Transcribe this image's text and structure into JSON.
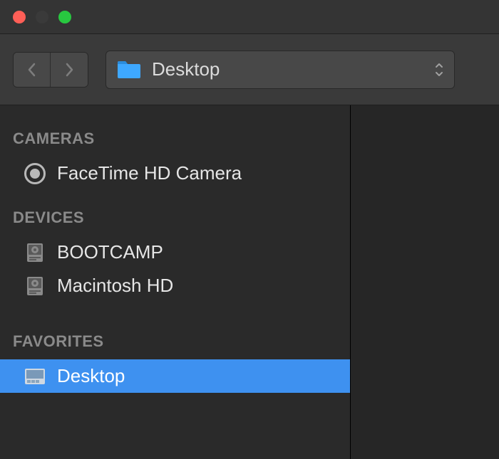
{
  "titlebar": {
    "traffic": {
      "close": "close",
      "minimize": "minimize",
      "maximize": "maximize"
    }
  },
  "toolbar": {
    "location_label": "Desktop"
  },
  "sidebar": {
    "sections": [
      {
        "header": "CAMERAS",
        "items": [
          {
            "label": "FaceTime HD Camera"
          }
        ]
      },
      {
        "header": "DEVICES",
        "items": [
          {
            "label": "BOOTCAMP"
          },
          {
            "label": "Macintosh HD"
          }
        ]
      },
      {
        "header": "FAVORITES",
        "items": [
          {
            "label": "Desktop"
          }
        ]
      }
    ]
  }
}
